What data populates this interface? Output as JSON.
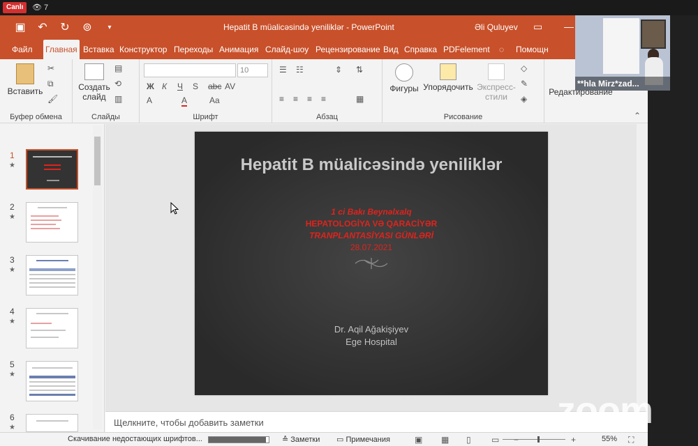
{
  "zoom": {
    "live_label": "Canlı",
    "viewer_count": "7",
    "participant_name": "**hla Mirz*zad...",
    "watermark": "zoom"
  },
  "window": {
    "doc_title": "Hepatit B müalicəsində yeniliklər  -  PowerPoint",
    "user_name": "Əli Quluyev"
  },
  "tabs": [
    "Файл",
    "Главная",
    "Вставка",
    "Конструктор",
    "Переходы",
    "Анимация",
    "Слайд-шоу",
    "Рецензирование",
    "Вид",
    "Справка",
    "PDFelement",
    "Помощн"
  ],
  "active_tab": "Главная",
  "ribbon": {
    "paste": "Вставить",
    "new_slide_1": "Создать",
    "new_slide_2": "слайд",
    "shapes": "Фигуры",
    "arrange": "Упорядочить",
    "express_1": "Экспресс-",
    "express_2": "стили",
    "editing": "Редактирование",
    "font_size": "10",
    "groups": {
      "clipboard": "Буфер обмена",
      "slides": "Слайды",
      "font": "Шрифт",
      "paragraph": "Абзац",
      "drawing": "Рисование"
    }
  },
  "thumbnails": [
    {
      "num": "1",
      "selected": true
    },
    {
      "num": "2",
      "selected": false
    },
    {
      "num": "3",
      "selected": false
    },
    {
      "num": "4",
      "selected": false
    },
    {
      "num": "5",
      "selected": false
    },
    {
      "num": "6",
      "selected": false
    }
  ],
  "slide": {
    "title": "Hepatit B müalicəsində yeniliklər",
    "line1": "1 ci Bakı Beynəlxalq",
    "line2": "HEPATOLOGİYA VƏ QARACİYƏR",
    "line3": "TRANPLANTASİYASI GÜNLƏRİ",
    "date": "28.07.2021",
    "author": "Dr. Aqil Ağakişiyev",
    "hospital": "Ege Hospital"
  },
  "notes_placeholder": "Щелкните, чтобы добавить заметки",
  "status": {
    "text": "Скачивание недостающих шрифтов...",
    "progress": 0.95,
    "notes": "Заметки",
    "comments": "Примечания",
    "zoom": "55%"
  }
}
